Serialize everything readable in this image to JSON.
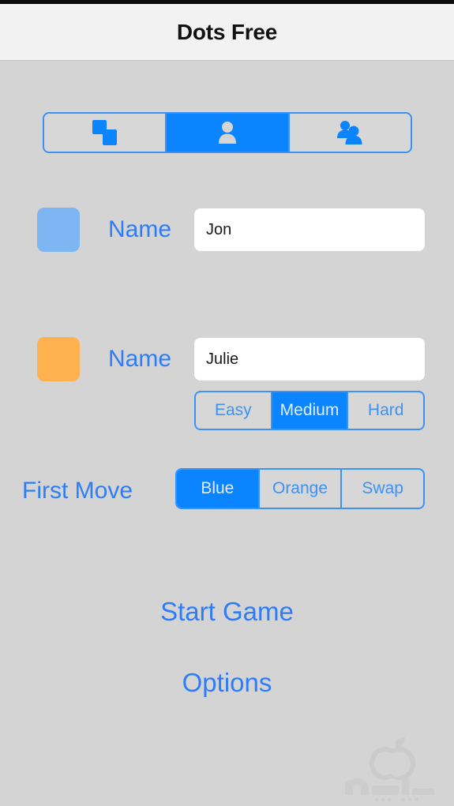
{
  "window": {
    "title": "Dots Free"
  },
  "mode_selector": {
    "name": "game-mode-selector",
    "selected_index": 1,
    "options": [
      {
        "icon": "two-dots-icon",
        "label": "Two Dots",
        "selected": false
      },
      {
        "icon": "single-person-icon",
        "label": "Single Player",
        "selected": true
      },
      {
        "icon": "two-people-icon",
        "label": "Two Players",
        "selected": false
      }
    ]
  },
  "players": [
    {
      "swatch_color": "#7DB6F2",
      "label": "Name",
      "value": "Jon",
      "placeholder": "Name"
    },
    {
      "swatch_color": "#FDB24F",
      "label": "Name",
      "value": "Julie",
      "placeholder": "Name"
    }
  ],
  "difficulty": {
    "selected": "Medium",
    "options": [
      {
        "label": "Easy",
        "selected": false
      },
      {
        "label": "Medium",
        "selected": true
      },
      {
        "label": "Hard",
        "selected": false
      }
    ]
  },
  "first_move": {
    "label": "First Move",
    "selected": "Blue",
    "options": [
      {
        "label": "Blue",
        "selected": true
      },
      {
        "label": "Orange",
        "selected": false
      },
      {
        "label": "Swap",
        "selected": false
      }
    ]
  },
  "actions": {
    "start_game": "Start Game",
    "options": "Options"
  },
  "colors": {
    "accent_blue": "#2d7dfb",
    "selected_blue": "#0a84ff",
    "border_blue": "#3b92f7",
    "background": "#d4d4d4",
    "titlebar": "#f2f2f2"
  }
}
